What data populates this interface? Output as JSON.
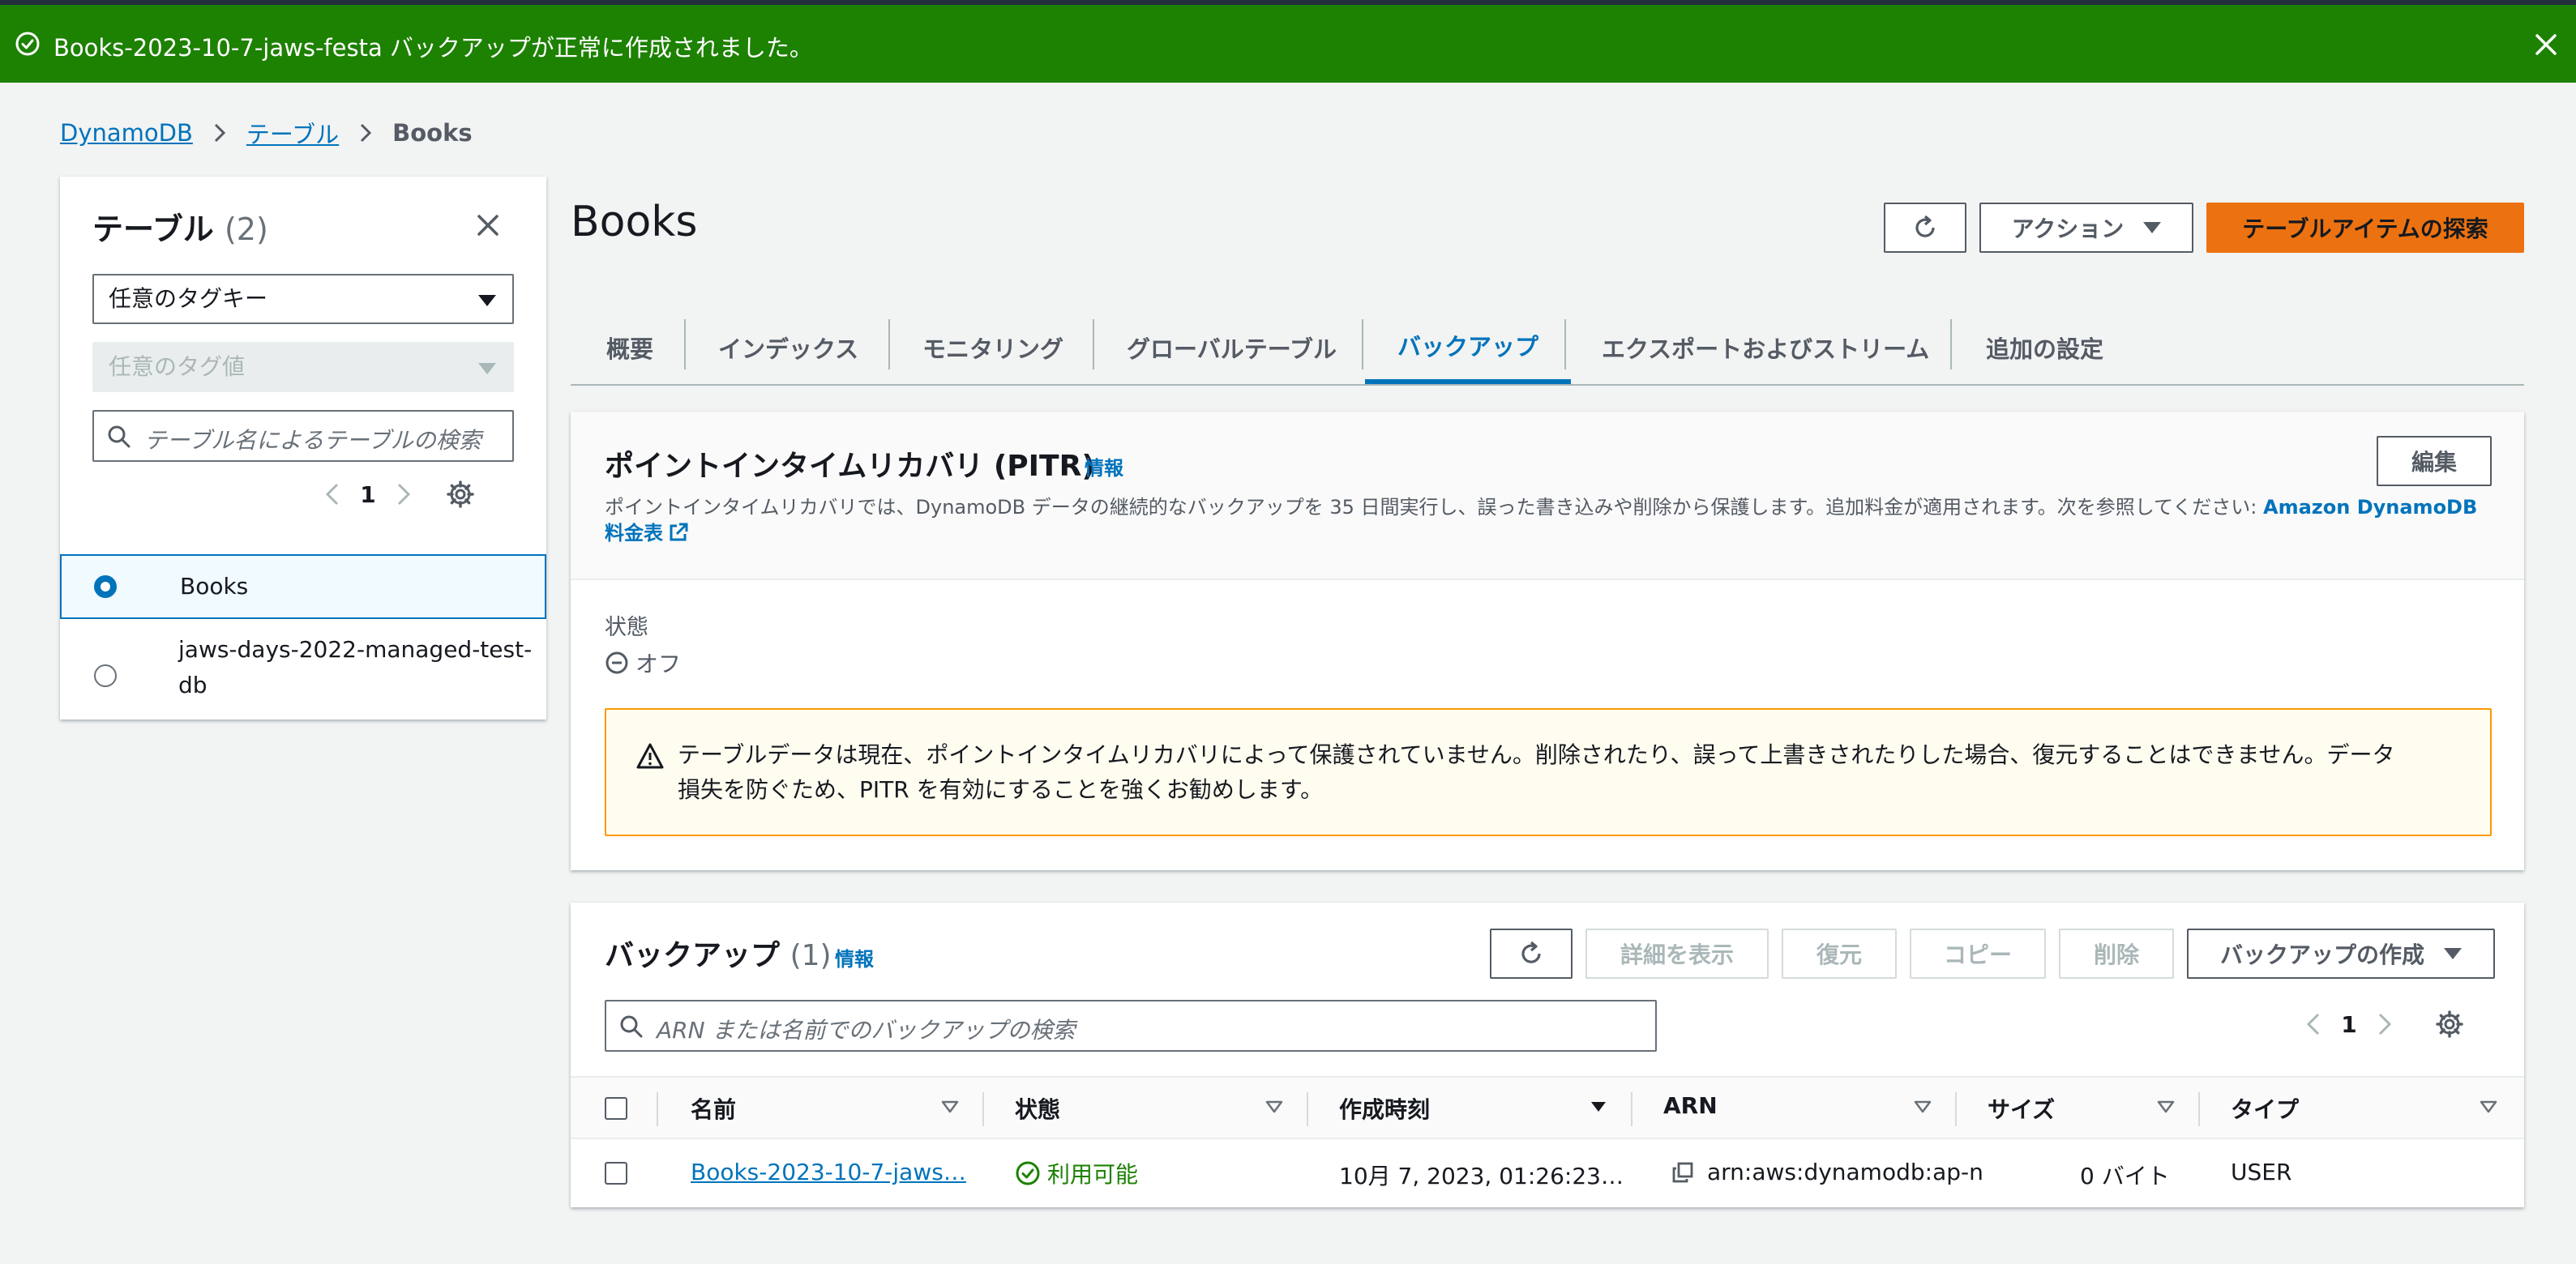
{
  "flash": {
    "message": "Books-2023-10-7-jaws-festa バックアップが正常に作成されました。",
    "color": "#1d8102"
  },
  "breadcrumb": {
    "items": [
      "DynamoDB",
      "テーブル"
    ],
    "current": "Books"
  },
  "sidebar": {
    "title": "テーブル",
    "count": "(2)",
    "tag_key": "任意のタグキー",
    "tag_value": "任意のタグ値",
    "search_placeholder": "テーブル名によるテーブルの検索",
    "page": "1",
    "tables": [
      {
        "name": "Books",
        "selected": true
      },
      {
        "name": "jaws-days-2022-managed-test-db",
        "name_line1": "jaws-days-2022-managed-test-",
        "name_line2": "db",
        "selected": false
      }
    ]
  },
  "page": {
    "title": "Books",
    "actions_label": "アクション",
    "explore_label": "テーブルアイテムの探索",
    "accent_color": "#ec7211"
  },
  "tabs": [
    {
      "label": "概要"
    },
    {
      "label": "インデックス"
    },
    {
      "label": "モニタリング"
    },
    {
      "label": "グローバルテーブル"
    },
    {
      "label": "バックアップ",
      "active": true
    },
    {
      "label": "エクスポートおよびストリーム"
    },
    {
      "label": "追加の設定"
    }
  ],
  "pitr": {
    "title": "ポイントインタイムリカバリ (PITR)",
    "info": "情報",
    "edit_label": "編集",
    "description": "ポイントインタイムリカバリでは、DynamoDB データの継続的なバックアップを 35 日間実行し、誤った書き込みや削除から保護します。追加料金が適用されます。次を参照してください: ",
    "link_text": "Amazon DynamoDB 料金表",
    "status_label": "状態",
    "status_value": "オフ",
    "warning": "テーブルデータは現在、ポイントインタイムリカバリによって保護されていません。削除されたり、誤って上書きされたりした場合、復元することはできません。データ損失を防ぐため、PITR を有効にすることを強くお勧めします。"
  },
  "backups": {
    "title": "バックアップ",
    "count": "(1)",
    "info": "情報",
    "buttons": {
      "details": "詳細を表示",
      "restore": "復元",
      "copy": "コピー",
      "delete": "削除",
      "create": "バックアップの作成"
    },
    "search_placeholder": "ARN または名前でのバックアップの検索",
    "page": "1",
    "columns": [
      "名前",
      "状態",
      "作成時刻",
      "ARN",
      "サイズ",
      "タイプ"
    ],
    "rows": [
      {
        "name": "Books-2023-10-7-jaws…",
        "status": "利用可能",
        "created": "10月 7, 2023, 01:26:23…",
        "arn": "arn:aws:dynamodb:ap-n",
        "size": "0 バイト",
        "type": "USER"
      }
    ]
  }
}
